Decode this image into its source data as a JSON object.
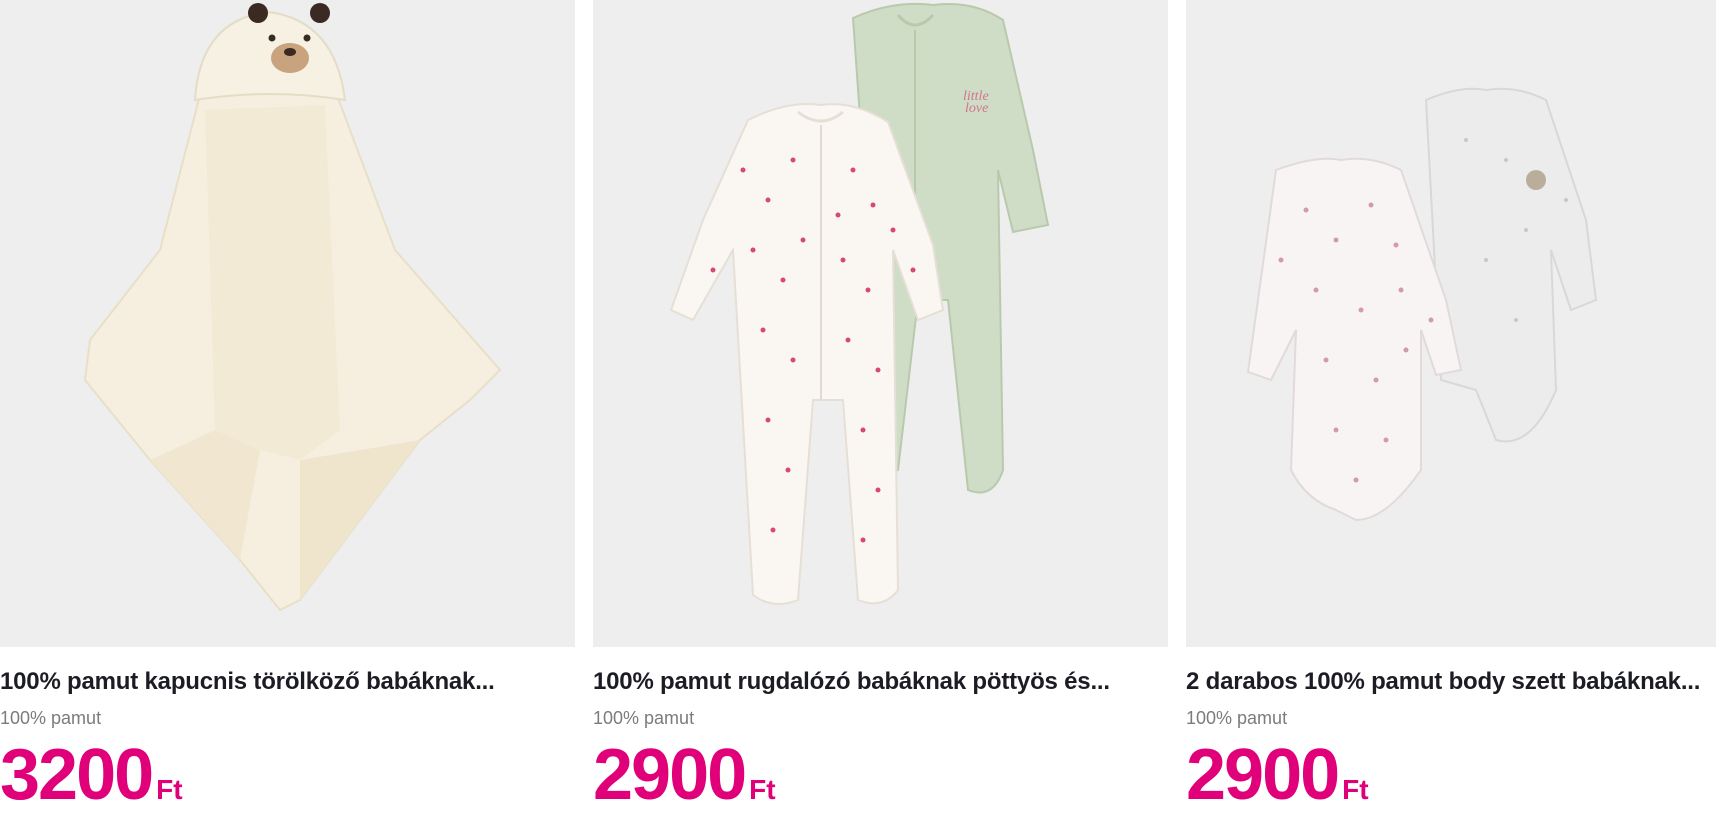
{
  "products": [
    {
      "title": "100% pamut kapucnis törölköző babáknak...",
      "subtitle": "100% pamut",
      "price": "3200",
      "currency": "Ft",
      "image_icon": "bear-hooded-towel-image"
    },
    {
      "title": "100% pamut rugdalózó babáknak pöttyös és...",
      "subtitle": "100% pamut",
      "price": "2900",
      "currency": "Ft",
      "image_icon": "sleepsuit-set-image"
    },
    {
      "title": "2 darabos 100% pamut body szett babáknak...",
      "subtitle": "100% pamut",
      "price": "2900",
      "currency": "Ft",
      "image_icon": "bodysuit-set-image"
    }
  ],
  "colors": {
    "price": "#e0007a",
    "title": "#1c1c24",
    "subtitle": "#7b7b80",
    "image_bg": "#eeeeef"
  }
}
